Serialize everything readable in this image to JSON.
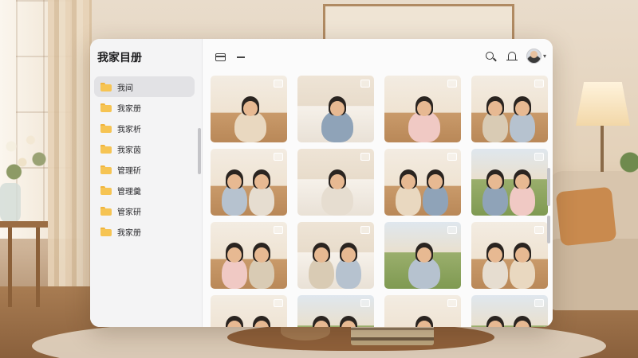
{
  "app": {
    "title": "我家目册"
  },
  "sidebar": {
    "items": [
      {
        "label": "我间",
        "selected": true
      },
      {
        "label": "我家册",
        "selected": false
      },
      {
        "label": "我家析",
        "selected": false
      },
      {
        "label": "我家茵",
        "selected": false
      },
      {
        "label": "管理斫",
        "selected": false
      },
      {
        "label": "管理羹",
        "selected": false
      },
      {
        "label": "管家研",
        "selected": false
      },
      {
        "label": "我家册",
        "selected": false
      }
    ]
  },
  "toolbar": {
    "left_icons": [
      "window-icon",
      "minimize-icon"
    ],
    "right_icons": [
      "search-icon",
      "bell-icon",
      "avatar",
      "chevron-down-icon"
    ]
  },
  "photos": [
    {
      "scene": "sofa",
      "people": 1
    },
    {
      "scene": "bed",
      "people": 1
    },
    {
      "scene": "sofa",
      "people": 1
    },
    {
      "scene": "sofa",
      "people": 2
    },
    {
      "scene": "sofa",
      "people": 2
    },
    {
      "scene": "bed",
      "people": 1
    },
    {
      "scene": "sofa",
      "people": 2
    },
    {
      "scene": "outdoor",
      "people": 2
    },
    {
      "scene": "sofa",
      "people": 2
    },
    {
      "scene": "bed",
      "people": 2
    },
    {
      "scene": "outdoor",
      "people": 1
    },
    {
      "scene": "sofa",
      "people": 2
    },
    {
      "scene": "sofa",
      "people": 2
    },
    {
      "scene": "outdoor",
      "people": 2
    },
    {
      "scene": "sofa",
      "people": 1
    },
    {
      "scene": "outdoor",
      "people": 2
    }
  ],
  "colors": {
    "accent_folder": "#f6c453",
    "sidebar_bg": "#f4f4f5",
    "selected_bg": "#e2e2e5"
  }
}
